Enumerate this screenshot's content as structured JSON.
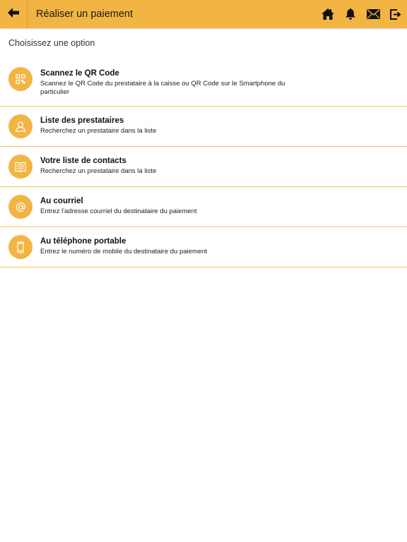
{
  "header": {
    "title": "Réaliser un paiement",
    "back_icon": "arrow-left-icon",
    "actions": [
      "home-icon",
      "bell-icon",
      "mail-icon",
      "logout-icon"
    ]
  },
  "prompt": "Choisissez une option",
  "options": [
    {
      "icon": "qr-code-icon",
      "label": "Scannez le QR Code",
      "description": "Scannez le QR Code du prestataire à la caisse ou QR Code sur le Smartphone du particulier"
    },
    {
      "icon": "user-icon",
      "label": "Liste des prestataires",
      "description": "Recherchez un prestataire dans la liste"
    },
    {
      "icon": "contacts-book-icon",
      "label": "Votre liste de contacts",
      "description": "Recherchez un prestataire dans la liste"
    },
    {
      "icon": "at-icon",
      "label": "Au courriel",
      "description": "Entrez l'adresse courriel du destinataire du paiement"
    },
    {
      "icon": "mobile-phone-icon",
      "label": "Au téléphone portable",
      "description": "Entrez le numéro de mobile du destinataire du paiement"
    }
  ],
  "colors": {
    "accent": "#f2b543",
    "divider": "#f2c45e"
  }
}
